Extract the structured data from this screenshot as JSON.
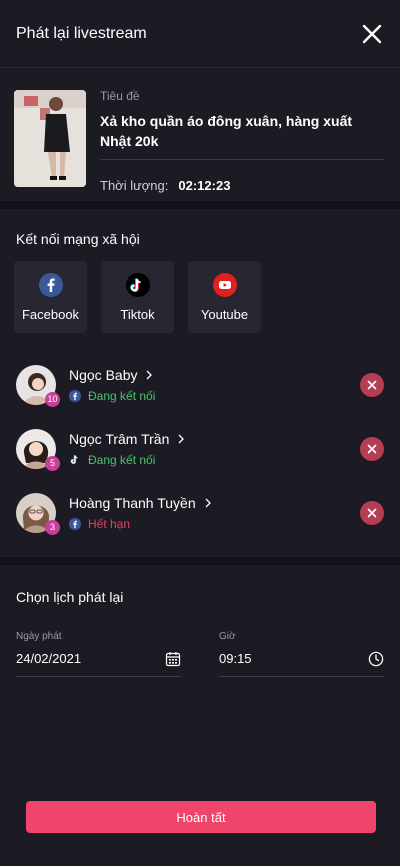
{
  "header": {
    "title": "Phát lại livestream"
  },
  "video": {
    "title_label": "Tiêu đề",
    "title": "Xả kho quần áo đông xuân, hàng xuất Nhật 20k",
    "duration_label": "Thời lượng:",
    "duration": "02:12:23"
  },
  "social": {
    "title": "Kết nối mạng xã hội",
    "items": [
      {
        "label": "Facebook",
        "icon": "facebook-icon",
        "color": "#3b5998"
      },
      {
        "label": "Tiktok",
        "icon": "tiktok-icon",
        "color": "#000000"
      },
      {
        "label": "Youtube",
        "icon": "youtube-icon",
        "color": "#e0221f"
      }
    ]
  },
  "accounts": [
    {
      "name": "Ngọc Baby",
      "badge": "10",
      "platform": "facebook",
      "status": "Đang kết nối",
      "status_color": "#46c46b"
    },
    {
      "name": "Ngọc Trâm Trần",
      "badge": "5",
      "platform": "tiktok",
      "status": "Đang kết nối",
      "status_color": "#46c46b"
    },
    {
      "name": "Hoàng Thanh Tuyền",
      "badge": "3",
      "platform": "facebook",
      "status": "Hết hạn",
      "status_color": "#e2425b"
    }
  ],
  "schedule": {
    "title": "Chọn lịch phát lại",
    "date_label": "Ngày phát",
    "date_value": "24/02/2021",
    "time_label": "Giờ",
    "time_value": "09:15"
  },
  "submit_label": "Hoàn tất",
  "colors": {
    "accent": "#f0456b",
    "background": "#1c1b24",
    "remove": "#b53f52"
  }
}
